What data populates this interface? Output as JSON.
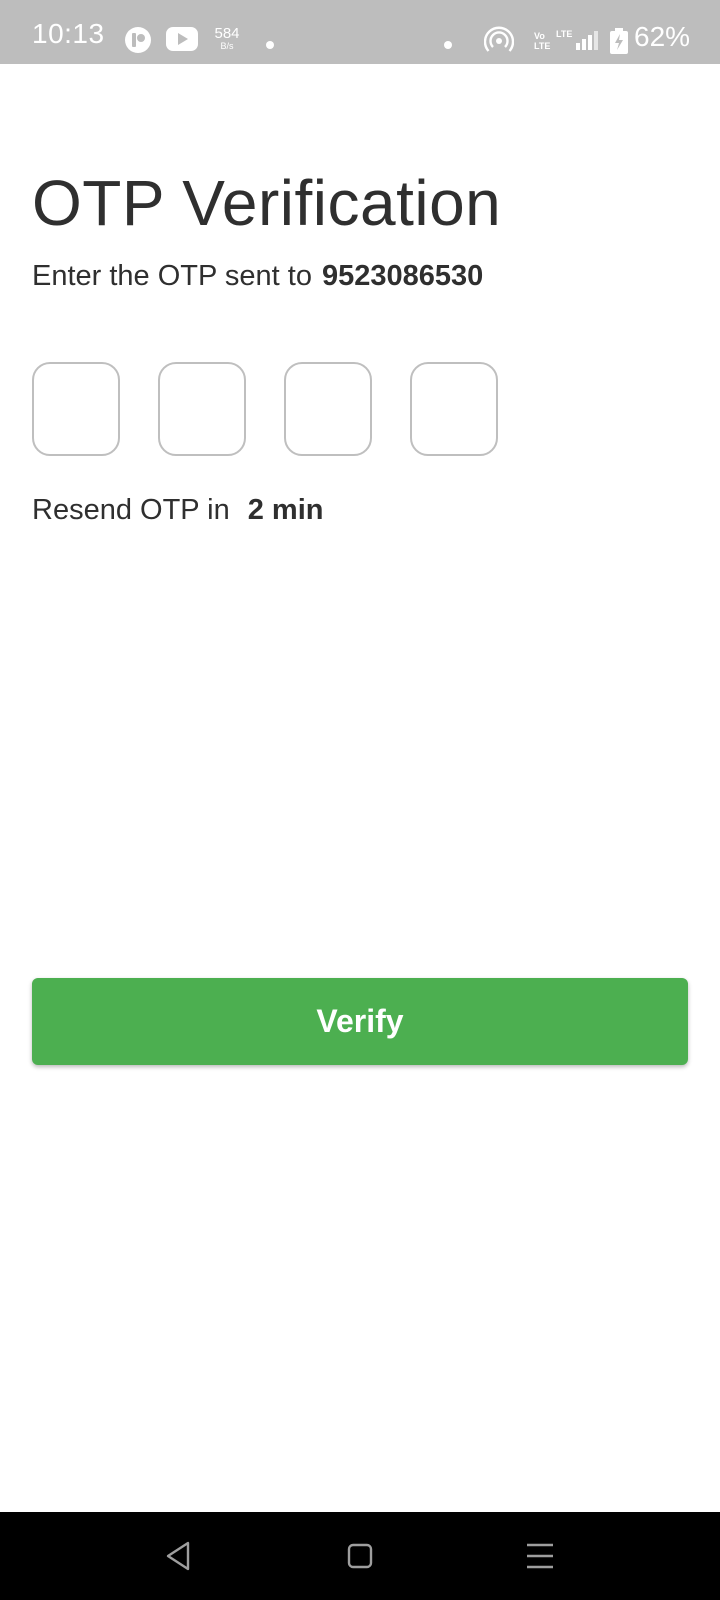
{
  "status_bar": {
    "time": "10:13",
    "net_speed_value": "584",
    "net_speed_unit": "B/s",
    "volte_top": "Vo",
    "volte_bottom": "LTE",
    "lte_label": "LTE",
    "battery_percent": "62%",
    "icons": [
      "app-notification-icon",
      "youtube-icon",
      "dot-icon",
      "dot-icon",
      "hotspot-icon",
      "volte-icon",
      "signal-icon",
      "battery-charging-icon"
    ]
  },
  "otp": {
    "title": "OTP Verification",
    "subtitle_prefix": "Enter the OTP sent to",
    "phone_number": "9523086530",
    "boxes": [
      "",
      "",
      "",
      ""
    ],
    "resend_prefix": "Resend OTP in",
    "resend_timer": "2 min",
    "verify_label": "Verify"
  },
  "nav_bar": {
    "icons": [
      "back-icon",
      "home-icon",
      "menu-icon"
    ]
  },
  "colors": {
    "status_bar_bg": "#bdbdbd",
    "primary_button": "#4caf50",
    "text": "#2f2f2f",
    "otp_border": "#bfbfbf",
    "nav_bar_bg": "#000000"
  }
}
